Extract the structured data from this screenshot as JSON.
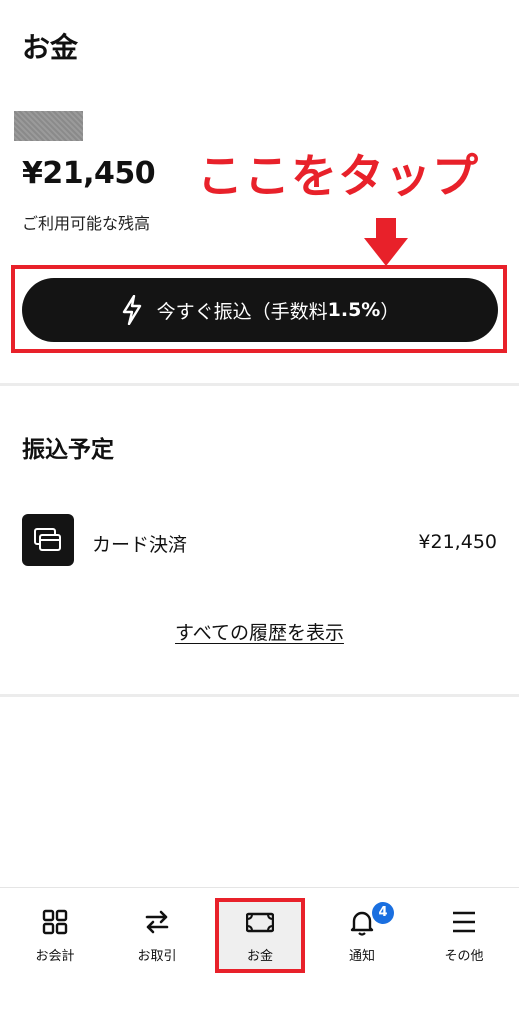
{
  "header": {
    "title": "お金"
  },
  "balance": {
    "amount": "¥21,450",
    "label": "ご利用可能な残高"
  },
  "annotation": {
    "text": "ここをタップ",
    "color": "#e8212a"
  },
  "transfer_button": {
    "label_prefix": "今すぐ振込（手数料",
    "label_fee": "1.5%",
    "label_suffix": "）",
    "icon": "lightning-icon"
  },
  "scheduled": {
    "title": "振込予定",
    "items": [
      {
        "label": "カード決済",
        "amount": "¥21,450",
        "icon": "card-payment-icon"
      }
    ],
    "history_link": "すべての履歴を表示"
  },
  "bottom_nav": {
    "items": [
      {
        "label": "お会計",
        "icon": "grid-icon"
      },
      {
        "label": "お取引",
        "icon": "transfer-arrows-icon"
      },
      {
        "label": "お金",
        "icon": "money-icon",
        "active": true
      },
      {
        "label": "通知",
        "icon": "bell-icon",
        "badge": "4"
      },
      {
        "label": "その他",
        "icon": "menu-icon"
      }
    ]
  },
  "colors": {
    "accent_red": "#e8212a",
    "button_bg": "#141414",
    "badge_blue": "#1a6fe0"
  }
}
